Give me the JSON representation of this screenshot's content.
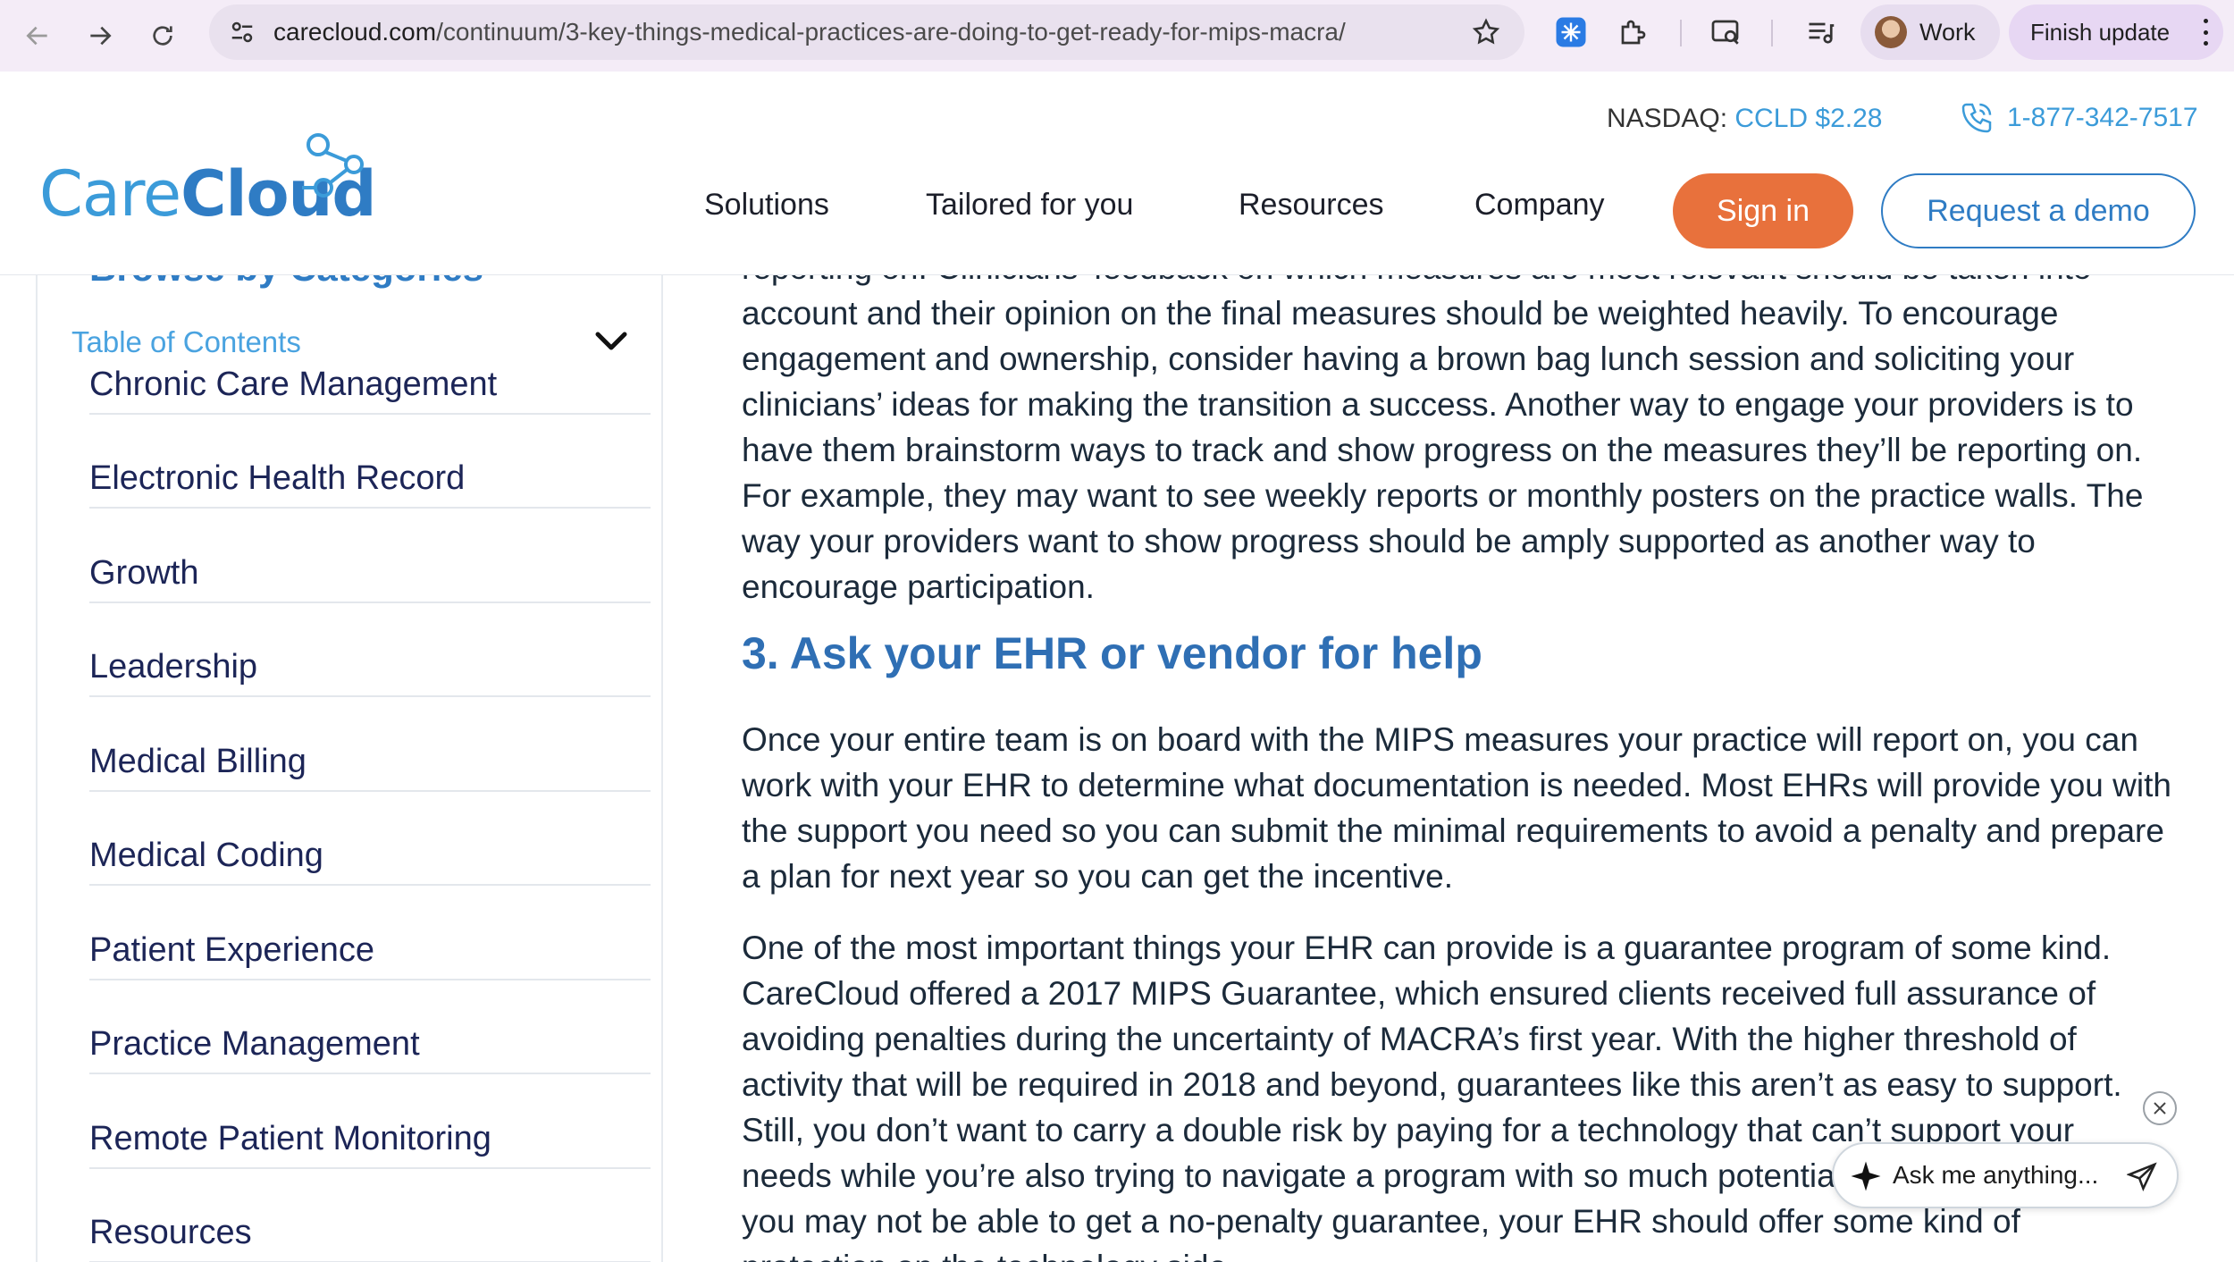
{
  "browser": {
    "url_host": "carecloud.com",
    "url_path": "/continuum/3-key-things-medical-practices-are-doing-to-get-ready-for-mips-macra/",
    "profile_name": "Work",
    "finish_update": "Finish update"
  },
  "header": {
    "logo_care": "Care",
    "logo_cloud": "Cloud",
    "nasdaq_label": "NASDAQ:",
    "nasdaq_ticker": "CCLD $2.28",
    "phone": "1-877-342-7517",
    "nav": [
      "Solutions",
      "Tailored for you",
      "Resources",
      "Company"
    ],
    "sign_in": "Sign in",
    "request_demo": "Request a demo"
  },
  "sidebar": {
    "heading": "Browse by Categories",
    "toc_label": "Table of Contents",
    "categories": [
      "Chronic Care Management",
      "Electronic Health Record",
      "Growth",
      "Leadership",
      "Medical Billing",
      "Medical Coding",
      "Patient Experience",
      "Practice Management",
      "Remote Patient Monitoring",
      "Resources"
    ]
  },
  "article": {
    "p1": "reporting on. Clinicians' feedback on which measures are most relevant should be taken into account and their opinion on the final measures should be weighted heavily. To encourage engagement and ownership, consider having a brown bag lunch session and soliciting your clinicians’ ideas for making the transition a success. Another way to engage your providers is to have them brainstorm ways to track and show progress on the measures they’ll be reporting on. For example, they may want to see weekly reports or monthly posters on the practice walls. The way your providers want to show progress should be amply supported as another way to encourage participation.",
    "h3": "3. Ask your EHR or vendor for help",
    "p2": "Once your entire team is on board with the MIPS measures your practice will report on, you can work with your EHR to determine what documentation is needed. Most EHRs will provide you with the support you need so you can submit the minimal requirements to avoid a penalty and prepare a plan for next year so you can get the incentive.",
    "p3": "One of the most important things your EHR can provide is a guarantee program of some kind. CareCloud offered a 2017 MIPS Guarantee, which ensured clients received full assurance of avoiding penalties during the uncertainty of MACRA’s first year. With the higher threshold of activity that will be required in 2018 and beyond, guarantees like this aren’t as easy to support. Still, you don’t want to carry a double risk by paying for a technology that can’t support your needs while you’re also trying to navigate a program with so much potential for change. Though you may not be able to get a no-penalty guarantee, your EHR should offer some kind of protection on the technology side."
  },
  "chat": {
    "placeholder": "Ask me anything..."
  },
  "colors": {
    "brand_blue": "#2f7cc4",
    "light_blue": "#3b9bd9",
    "sign_in_orange": "#e8713c",
    "category_text": "#1c2557",
    "chrome_bg": "#f4ecf7"
  },
  "icons": [
    "back-arrow-icon",
    "forward-arrow-icon",
    "reload-icon",
    "site-info-icon",
    "star-icon",
    "extension-snowflake-icon",
    "puzzle-icon",
    "tab-search-icon",
    "media-control-icon",
    "phone-icon",
    "chevron-down-icon",
    "sparkle-icon",
    "send-icon",
    "close-icon"
  ]
}
